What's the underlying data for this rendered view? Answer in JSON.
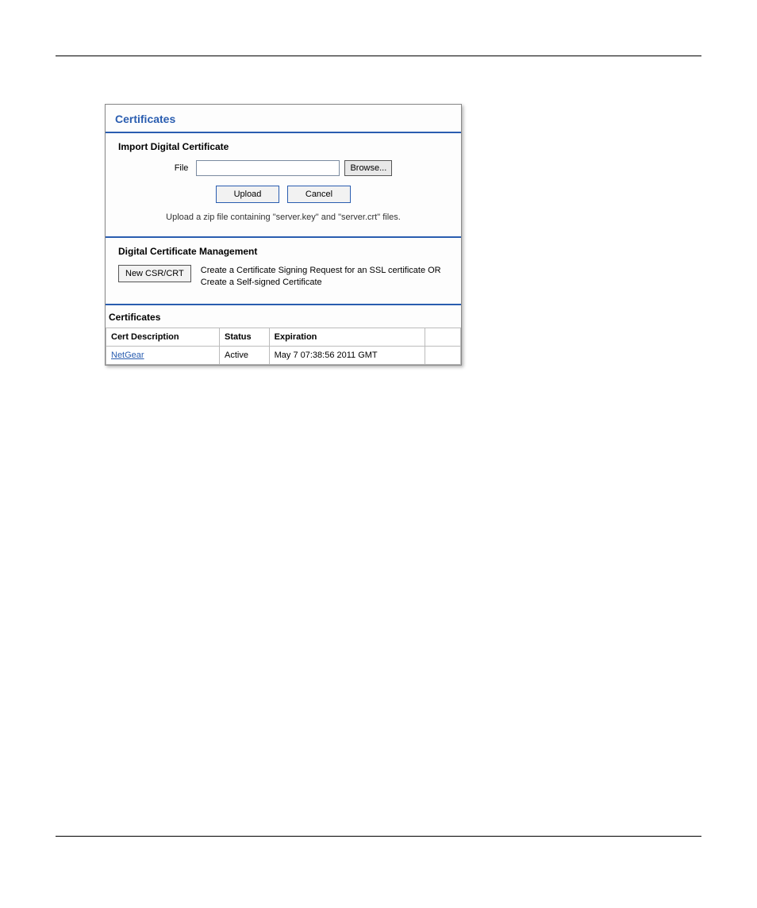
{
  "panel_title": "Certificates",
  "import": {
    "heading": "Import Digital Certificate",
    "file_label": "File",
    "browse_label": "Browse...",
    "upload_label": "Upload",
    "cancel_label": "Cancel",
    "hint": "Upload a zip file containing \"server.key\" and \"server.crt\" files."
  },
  "management": {
    "heading": "Digital Certificate Management",
    "new_csr_label": "New CSR/CRT",
    "description": "Create a Certificate Signing Request for an SSL certificate OR Create a Self-signed Certificate"
  },
  "certificates": {
    "heading": "Certificates",
    "columns": {
      "description": "Cert Description",
      "status": "Status",
      "expiration": "Expiration"
    },
    "rows": [
      {
        "description": "NetGear",
        "status": "Active",
        "expiration": "May 7 07:38:56 2011 GMT"
      }
    ]
  }
}
